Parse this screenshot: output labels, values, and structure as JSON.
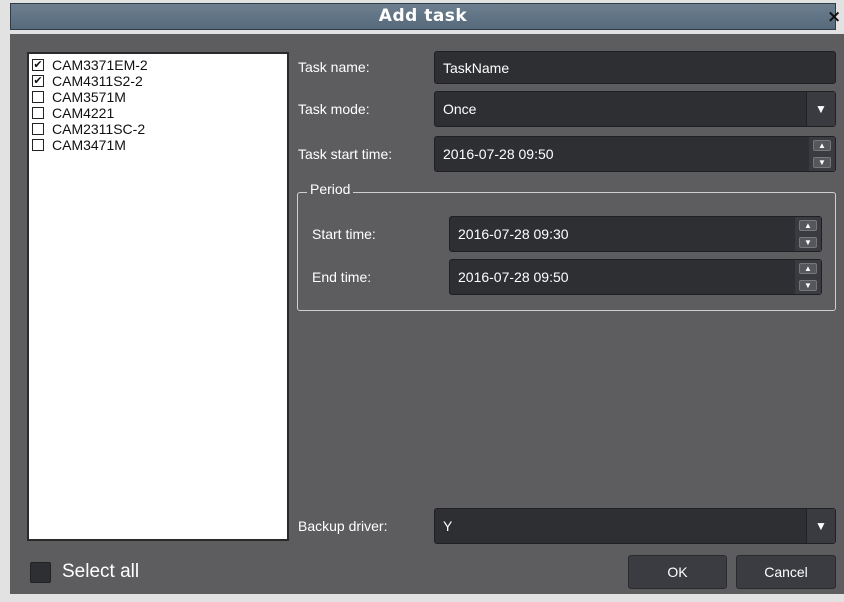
{
  "dialog": {
    "title": "Add task",
    "close_icon": "×"
  },
  "cameras": [
    {
      "name": "CAM3371EM-2",
      "checked": true
    },
    {
      "name": "CAM4311S2-2",
      "checked": true
    },
    {
      "name": "CAM3571M",
      "checked": false
    },
    {
      "name": "CAM4221",
      "checked": false
    },
    {
      "name": "CAM2311SC-2",
      "checked": false
    },
    {
      "name": "CAM3471M",
      "checked": false
    }
  ],
  "form": {
    "task_name_label": "Task name:",
    "task_name_value": "TaskName",
    "task_mode_label": "Task mode:",
    "task_mode_value": "Once",
    "task_start_label": "Task start time:",
    "task_start_value": "2016-07-28 09:50",
    "period_title": "Period",
    "start_time_label": "Start time:",
    "start_time_value": "2016-07-28 09:30",
    "end_time_label": "End time:",
    "end_time_value": "2016-07-28 09:50",
    "backup_label": "Backup driver:",
    "backup_value": "Y"
  },
  "footer": {
    "select_all": "Select all",
    "ok": "OK",
    "cancel": "Cancel"
  },
  "icons": {
    "dropdown_arrow": "▼",
    "spin_up": "▲",
    "spin_down": "▼",
    "checkmark": "✔"
  }
}
